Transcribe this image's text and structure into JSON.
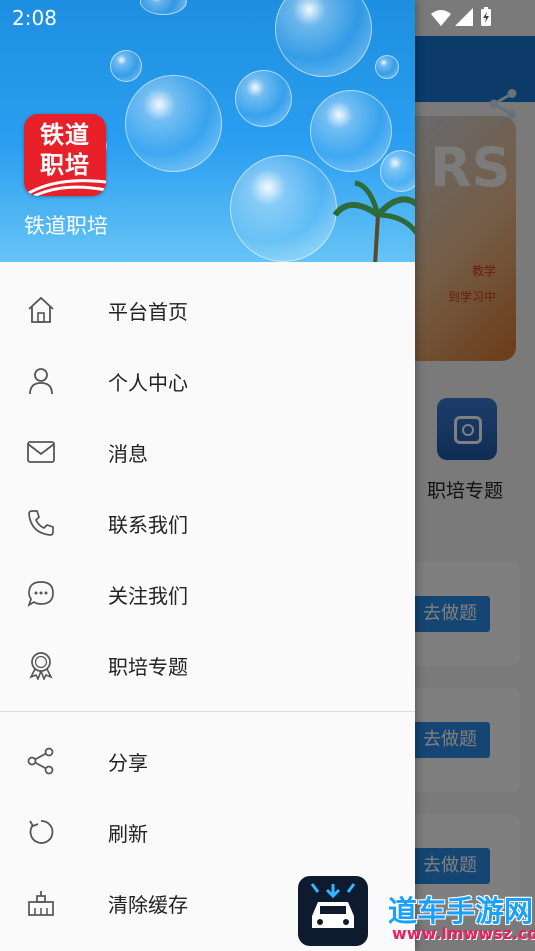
{
  "status_bar": {
    "time": "2:08"
  },
  "background": {
    "banner_text": "RS",
    "banner_line1": "教学",
    "banner_line2": "到学习中",
    "feature_label": "职培专题",
    "practice_buttons": [
      "去做题",
      "去做题",
      "去做题"
    ]
  },
  "drawer": {
    "app_logo_line1": "铁道",
    "app_logo_line2": "职培",
    "app_name": "铁道职培",
    "menu": [
      {
        "label": "平台首页",
        "icon": "home-icon"
      },
      {
        "label": "个人中心",
        "icon": "person-icon"
      },
      {
        "label": "消息",
        "icon": "mail-icon"
      },
      {
        "label": "联系我们",
        "icon": "phone-icon"
      },
      {
        "label": "关注我们",
        "icon": "chat-bubble-icon"
      },
      {
        "label": "职培专题",
        "icon": "badge-icon"
      }
    ],
    "menu2": [
      {
        "label": "分享",
        "icon": "share-icon"
      },
      {
        "label": "刷新",
        "icon": "refresh-icon"
      },
      {
        "label": "清除缓存",
        "icon": "clear-cache-icon"
      }
    ]
  },
  "watermark": {
    "text": "道车手游网",
    "url": "www.lmwwsz.com"
  }
}
